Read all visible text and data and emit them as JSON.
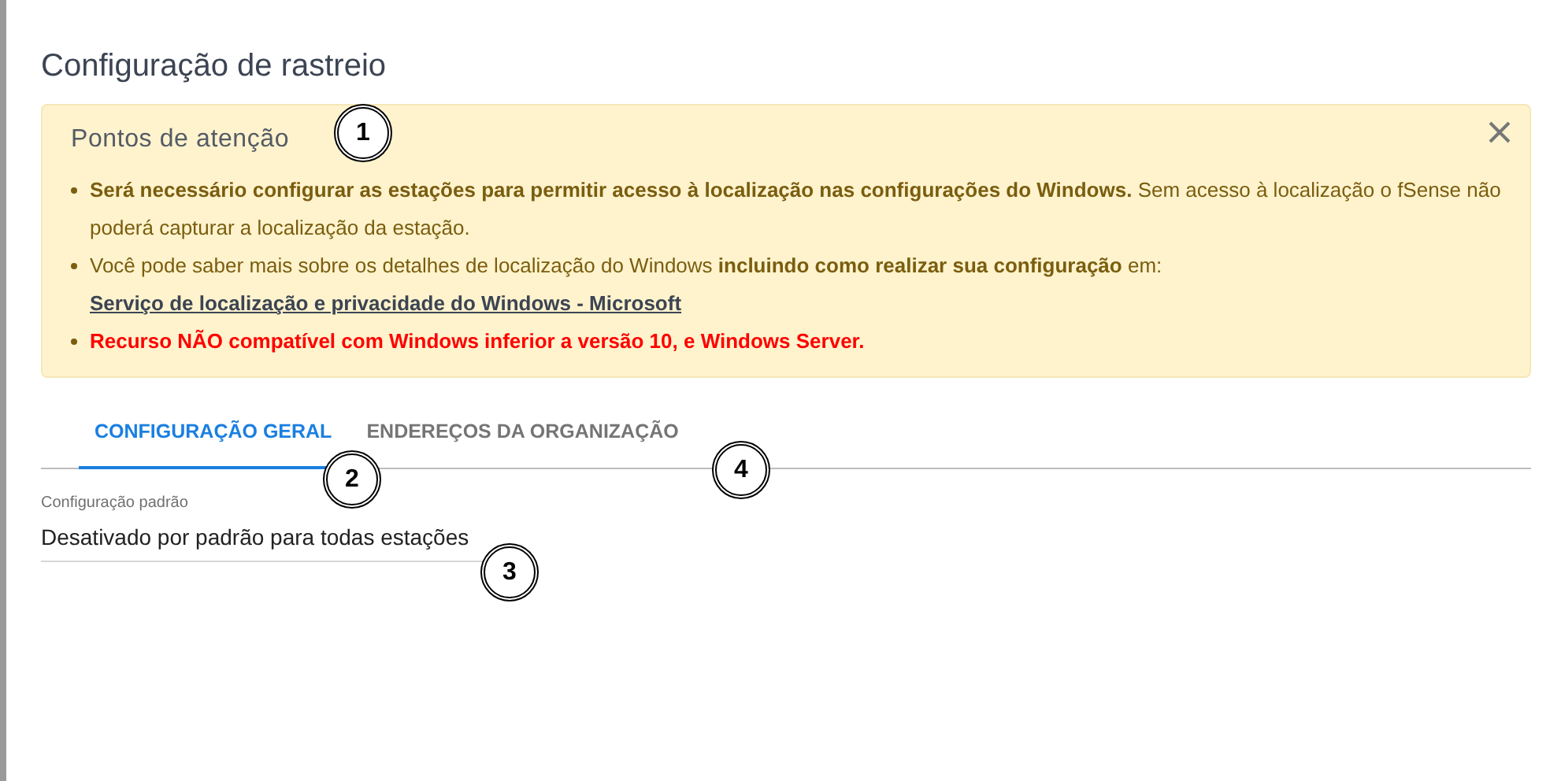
{
  "dialog": {
    "title": "Configuração de rastreio"
  },
  "alert": {
    "title": "Pontos de atenção",
    "bullets": [
      {
        "kind": "note",
        "text": "**Será necessário configurar as estações para permitir acesso à localização nas configurações do Windows.** Sem acesso à localização o fSense não poderá capturar a localização da estação."
      },
      {
        "kind": "note",
        "text": "Você pode saber mais sobre os detalhes de localização do Windows **incluindo como realizar sua configuração** em: ",
        "link": "Serviço de localização e privacidade do Windows - Microsoft"
      },
      {
        "kind": "warning",
        "text": "Recurso NÃO compatível com Windows inferior a versão 10, e Windows Server."
      }
    ]
  },
  "tabs": [
    {
      "label": "CONFIGURAÇÃO GERAL",
      "selected": true
    },
    {
      "label": "ENDEREÇOS DA ORGANIZAÇÃO",
      "selected": false
    }
  ],
  "field": {
    "label": "Configuração padrão",
    "value": "Desativado por padrão para todas estações"
  },
  "callouts": [
    "1",
    "2",
    "3",
    "4"
  ]
}
